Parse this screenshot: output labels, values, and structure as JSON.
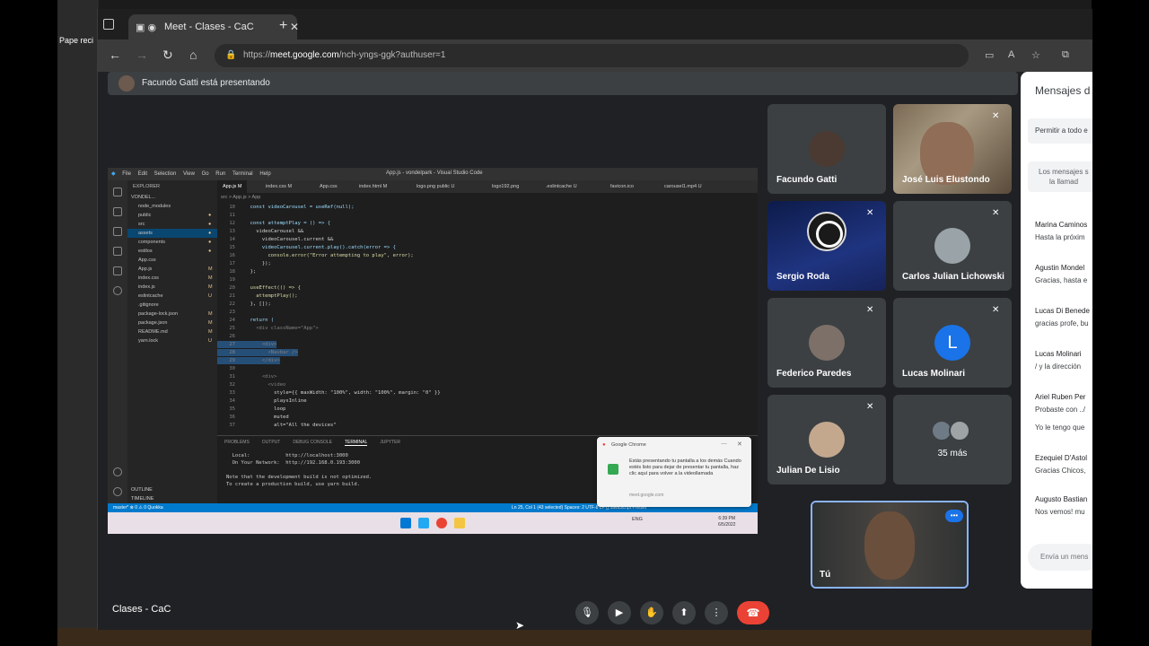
{
  "desktop": {
    "icon_label": "Pape reci"
  },
  "browser": {
    "tab_title": "Meet - Clases - CaC",
    "url_scheme": "https://",
    "url_host": "meet.google.com",
    "url_path": "/nch-yngs-ggk?authuser=1"
  },
  "meet": {
    "presenting_text": "Facundo Gatti está presentando",
    "meeting_name": "Clases - CaC",
    "self_label": "Tú",
    "more_count": "35 más",
    "participants": [
      {
        "name": "Facundo Gatti",
        "muted": false
      },
      {
        "name": "José Luis Elustondo",
        "muted": true
      },
      {
        "name": "Sergio Roda",
        "muted": true
      },
      {
        "name": "Carlos Julian Lichowski",
        "muted": true
      },
      {
        "name": "Federico Paredes",
        "muted": true
      },
      {
        "name": "Lucas Molinari",
        "muted": true,
        "initial": "L"
      },
      {
        "name": "Julian De Lisio",
        "muted": true
      }
    ]
  },
  "chat": {
    "title": "Mensajes d",
    "allow": "Permitir a todo e",
    "note_line1": "Los mensajes s",
    "note_line2": "la llamad",
    "messages": [
      {
        "who": "Marina Caminos",
        "text": "Hasta la próxim"
      },
      {
        "who": "Agustin Mondel",
        "text": "Gracias, hasta e"
      },
      {
        "who": "Lucas Di Benede",
        "text": "gracias profe, bu"
      },
      {
        "who": "Lucas Molinari",
        "text": "/ y la dirección"
      },
      {
        "who": "Ariel Ruben Per",
        "text": "Probaste con ../"
      },
      {
        "who": "",
        "text": "Yo le tengo que"
      },
      {
        "who": "Ezequiel D'Astol",
        "text": "Gracias Chicos,"
      },
      {
        "who": "Augusto Bastian",
        "text": "Nos vemos! mu"
      }
    ],
    "input_placeholder": "Envía un mens"
  },
  "shared_screen": {
    "vs_menu": [
      "File",
      "Edit",
      "Selection",
      "View",
      "Go",
      "Run",
      "Terminal",
      "Help"
    ],
    "vs_window_title": "App.js - vondelpark - Visual Studio Code",
    "explorer_header": "EXPLORER",
    "project": "VONDEL...",
    "files": [
      {
        "name": "node_modules",
        "mark": ""
      },
      {
        "name": "public",
        "mark": "●"
      },
      {
        "name": "src",
        "mark": "●"
      },
      {
        "name": "assets",
        "mark": "●",
        "selected": true
      },
      {
        "name": "components",
        "mark": "●"
      },
      {
        "name": "estilos",
        "mark": "●"
      },
      {
        "name": "App.css",
        "mark": ""
      },
      {
        "name": "App.js",
        "mark": "M"
      },
      {
        "name": "index.css",
        "mark": "M"
      },
      {
        "name": "index.js",
        "mark": "M"
      },
      {
        "name": "eslintcache",
        "mark": "U"
      },
      {
        "name": ".gitignore",
        "mark": ""
      },
      {
        "name": "package-lock.json",
        "mark": "M"
      },
      {
        "name": "package.json",
        "mark": "M"
      },
      {
        "name": "README.md",
        "mark": "M"
      },
      {
        "name": "yarn.lock",
        "mark": "U"
      }
    ],
    "editor_tabs": [
      "App.js M",
      "index.css M",
      "App.css",
      "index.html M",
      "logo.png public U",
      "logo192.png",
      ".eslintcache U",
      "favicon.ico",
      "carousel1.mp4 U"
    ],
    "breadcrumb": "src > App.js > App",
    "code": [
      {
        "n": "10",
        "t": "  const videoCarousel = useRef(null);"
      },
      {
        "n": "11",
        "t": ""
      },
      {
        "n": "12",
        "t": "  const attemptPlay = () => {"
      },
      {
        "n": "13",
        "t": "    videoCarousel &&"
      },
      {
        "n": "14",
        "t": "      videoCarousel.current &&"
      },
      {
        "n": "15",
        "t": "      videoCarousel.current.play().catch(error => {"
      },
      {
        "n": "16",
        "t": "        console.error(\"Error attempting to play\", error);"
      },
      {
        "n": "17",
        "t": "      });"
      },
      {
        "n": "18",
        "t": "  };"
      },
      {
        "n": "19",
        "t": ""
      },
      {
        "n": "20",
        "t": "  useEffect(() => {"
      },
      {
        "n": "21",
        "t": "    attemptPlay();"
      },
      {
        "n": "22",
        "t": "  }, []);"
      },
      {
        "n": "23",
        "t": ""
      },
      {
        "n": "24",
        "t": "  return ("
      },
      {
        "n": "25",
        "t": "    <div className=\"App\">"
      },
      {
        "n": "26",
        "t": ""
      },
      {
        "n": "27",
        "t": "      <div>"
      },
      {
        "n": "28",
        "t": "        <Navbar />"
      },
      {
        "n": "29",
        "t": "      </div>"
      },
      {
        "n": "30",
        "t": ""
      },
      {
        "n": "31",
        "t": "      <div>"
      },
      {
        "n": "32",
        "t": "        <video"
      },
      {
        "n": "33",
        "t": "          style={{ maxWidth: \"100%\", width: \"100%\", margin: \"0\" }}"
      },
      {
        "n": "34",
        "t": "          playsInline"
      },
      {
        "n": "35",
        "t": "          loop"
      },
      {
        "n": "36",
        "t": "          muted"
      },
      {
        "n": "37",
        "t": "          alt=\"All the devices\""
      }
    ],
    "panel_tabs": [
      "PROBLEMS",
      "OUTPUT",
      "DEBUG CONSOLE",
      "TERMINAL",
      "JUPYTER"
    ],
    "terminal": [
      "  Local:            http://localhost:3000",
      "  On Your Network:  http://192.168.0.193:3000",
      "",
      "Note that the development build is not optimized.",
      "To create a production build, use yarn build.",
      ""
    ],
    "outline": "OUTLINE",
    "timeline": "TIMELINE",
    "status_left": "master*  ⊗ 0 ⚠ 0   Quokka",
    "status_right": "Ln 25, Col 1 (43 selected)   Spaces: 2   UTF-8   LF   {} JavaScript   Prettier",
    "clock_time": "6:39 PM",
    "clock_date": "6/5/2022",
    "tray": "ENG",
    "notification": {
      "app": "Google Chrome",
      "body": "Estás presentando tu pantalla a los demás Cuando estés listo para dejar de presentar tu pantalla, haz clic aquí para volver a la videollamada",
      "source": "meet.google.com"
    }
  },
  "colors": {
    "accent": "#8ab4f8",
    "end_call": "#ea4335",
    "vs_status": "#007acc"
  }
}
